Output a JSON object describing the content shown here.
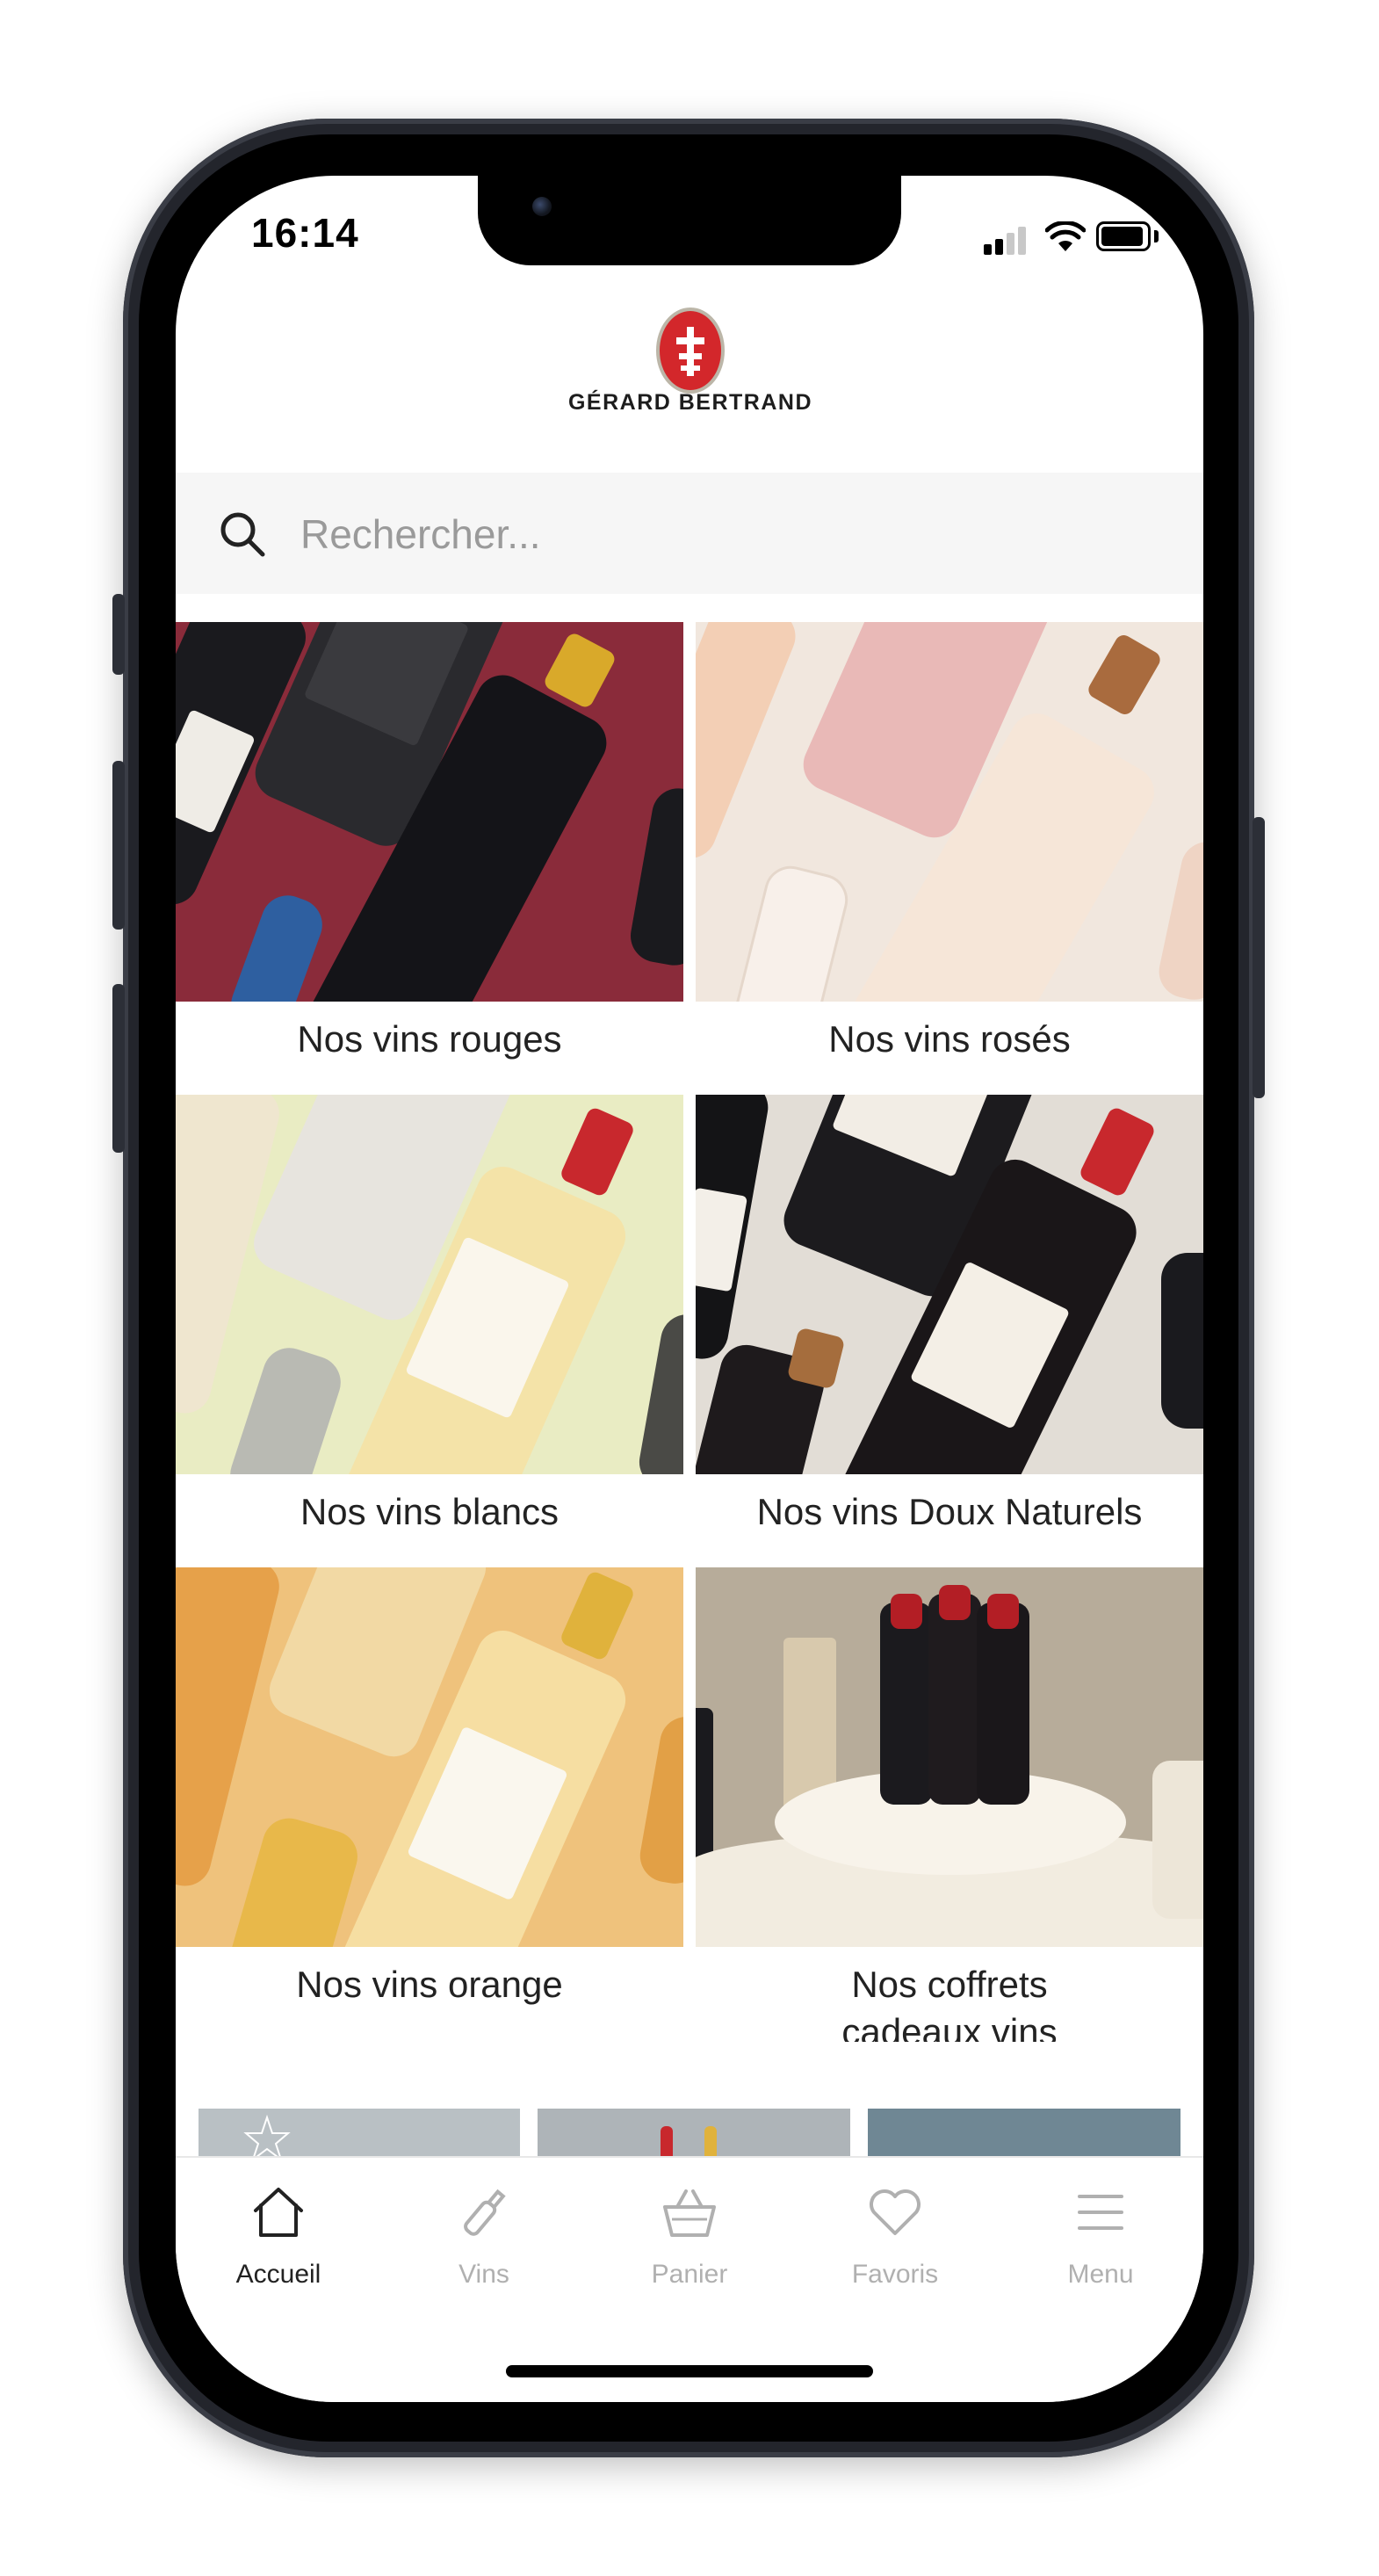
{
  "status_bar": {
    "time": "16:14"
  },
  "brand": {
    "name": "GÉRARD BERTRAND"
  },
  "search": {
    "placeholder": "Rechercher..."
  },
  "categories": [
    {
      "label": "Nos vins rouges"
    },
    {
      "label": "Nos vins rosés"
    },
    {
      "label": "Nos vins blancs"
    },
    {
      "label": "Nos vins Doux Naturels"
    },
    {
      "label": "Nos vins orange"
    },
    {
      "label": "Nos coffrets cadeaux vins"
    }
  ],
  "tab_bar": {
    "items": [
      {
        "label": "Accueil",
        "icon": "home-icon",
        "active": true
      },
      {
        "label": "Vins",
        "icon": "wine-bottle-icon",
        "active": false
      },
      {
        "label": "Panier",
        "icon": "basket-icon",
        "active": false
      },
      {
        "label": "Favoris",
        "icon": "heart-icon",
        "active": false
      },
      {
        "label": "Menu",
        "icon": "menu-icon",
        "active": false
      }
    ]
  },
  "colors": {
    "accent": "#d3272b",
    "active_tab": "#222222",
    "inactive_tab": "#b0b0b0",
    "search_bg": "#f6f6f6"
  }
}
